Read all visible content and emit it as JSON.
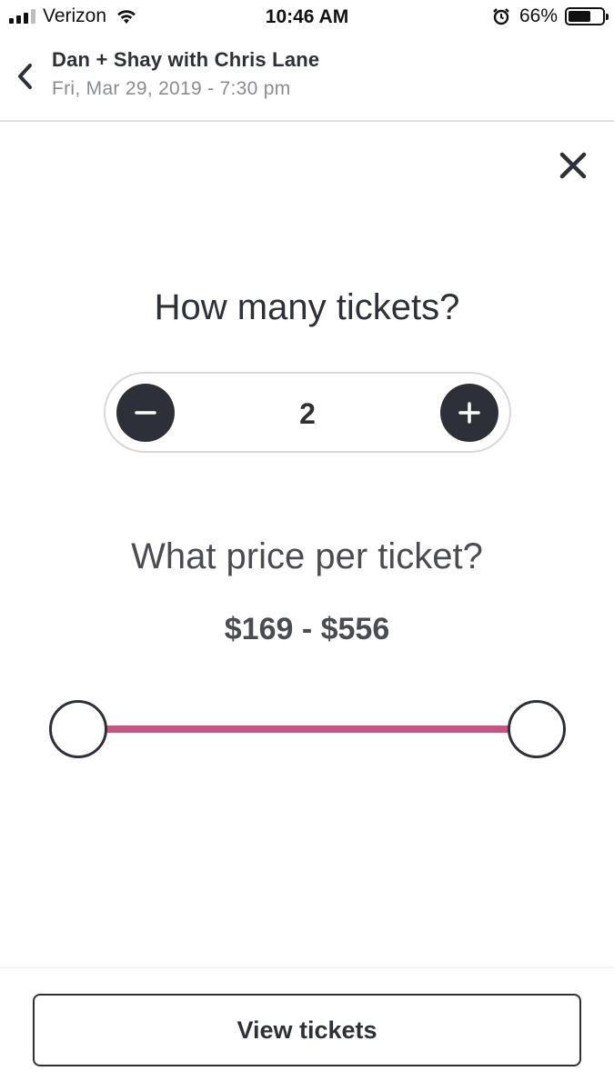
{
  "status_bar": {
    "carrier": "Verizon",
    "time": "10:46 AM",
    "battery_percent": "66%",
    "battery_level": 0.66,
    "icons": [
      "signal-icon",
      "wifi-icon",
      "alarm-icon",
      "battery-icon"
    ]
  },
  "header": {
    "title": "Dan + Shay with Chris Lane",
    "subtitle": "Fri, Mar 29, 2019 - 7:30 pm",
    "back_icon": "chevron-left-icon"
  },
  "dialog": {
    "close_icon": "close-icon",
    "quantity_question": "How many tickets?",
    "quantity_value": "2",
    "price_question": "What price per ticket?",
    "price_range": "$169 - $556",
    "price_min": 169,
    "price_max": 556,
    "slider_min_fraction": 0,
    "slider_max_fraction": 1
  },
  "footer": {
    "view_label": "View tickets"
  },
  "colors": {
    "text_dark": "#2e3038",
    "text_muted": "#8a8c93",
    "accent_track": "#c85486",
    "divider": "#e0e0e3"
  }
}
